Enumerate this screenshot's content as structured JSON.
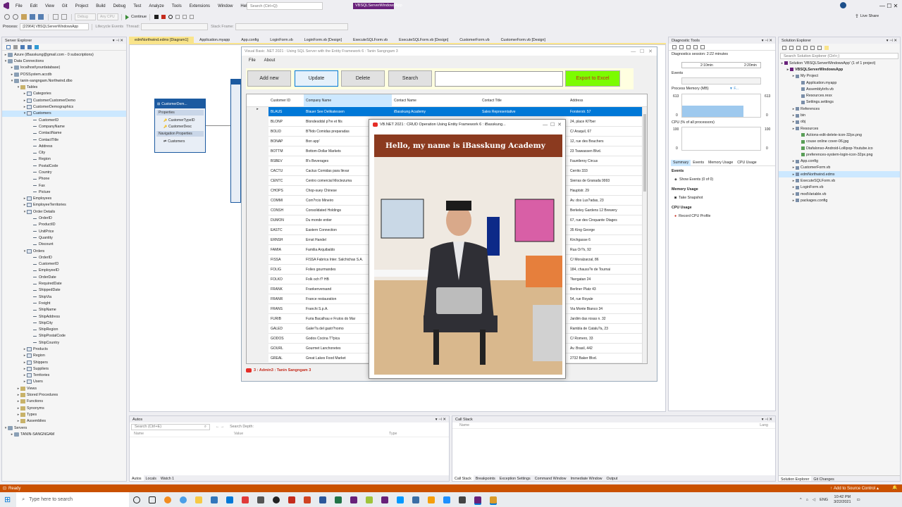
{
  "ide": {
    "menu": [
      "File",
      "Edit",
      "View",
      "Git",
      "Project",
      "Build",
      "Debug",
      "Test",
      "Analyze",
      "Tools",
      "Extensions",
      "Window",
      "Help"
    ],
    "search_placeholder": "Search (Ctrl+Q)",
    "solution_name": "VBSQLServerWindowsApp",
    "live_share": "Live Share",
    "toolbar": {
      "config": "Debug",
      "platform": "Any CPU",
      "continue_label": "Continue",
      "process_label": "Process:",
      "process_value": "[22964] VBSQLServerWindowsApp",
      "lifecycle_label": "Lifecycle Events",
      "thread_label": "Thread:",
      "stack_frame_label": "Stack Frame:"
    }
  },
  "server_explorer": {
    "title": "Server Explorer",
    "items": [
      {
        "indent": 0,
        "exp": "▸",
        "label": "Azure (iBasskung@gmail.com - 0 subscriptions)",
        "icon": "db"
      },
      {
        "indent": 0,
        "exp": "▾",
        "label": "Data Connections",
        "icon": "db"
      },
      {
        "indent": 1,
        "exp": "▸",
        "label": "localhost\\yourdatabase)",
        "icon": "db"
      },
      {
        "indent": 1,
        "exp": "▸",
        "label": "POSSystem.accdb",
        "icon": "db"
      },
      {
        "indent": 1,
        "exp": "▾",
        "label": "tanin-sangngam.Northwind.dbo",
        "icon": "db"
      },
      {
        "indent": 2,
        "exp": "▾",
        "label": "Tables",
        "icon": "fld"
      },
      {
        "indent": 3,
        "exp": "▸",
        "label": "Categories",
        "icon": "tbl"
      },
      {
        "indent": 3,
        "exp": "▸",
        "label": "CustomerCustomerDemo",
        "icon": "tbl"
      },
      {
        "indent": 3,
        "exp": "▸",
        "label": "CustomerDemographics",
        "icon": "tbl"
      },
      {
        "indent": 3,
        "exp": "▾",
        "label": "Customers",
        "icon": "tbl",
        "selected": true
      },
      {
        "indent": 4,
        "exp": "",
        "label": "CustomerID",
        "icon": "col"
      },
      {
        "indent": 4,
        "exp": "",
        "label": "CompanyName",
        "icon": "col"
      },
      {
        "indent": 4,
        "exp": "",
        "label": "ContactName",
        "icon": "col"
      },
      {
        "indent": 4,
        "exp": "",
        "label": "ContactTitle",
        "icon": "col"
      },
      {
        "indent": 4,
        "exp": "",
        "label": "Address",
        "icon": "col"
      },
      {
        "indent": 4,
        "exp": "",
        "label": "City",
        "icon": "col"
      },
      {
        "indent": 4,
        "exp": "",
        "label": "Region",
        "icon": "col"
      },
      {
        "indent": 4,
        "exp": "",
        "label": "PostalCode",
        "icon": "col"
      },
      {
        "indent": 4,
        "exp": "",
        "label": "Country",
        "icon": "col"
      },
      {
        "indent": 4,
        "exp": "",
        "label": "Phone",
        "icon": "col"
      },
      {
        "indent": 4,
        "exp": "",
        "label": "Fax",
        "icon": "col"
      },
      {
        "indent": 4,
        "exp": "",
        "label": "Picture",
        "icon": "col"
      },
      {
        "indent": 3,
        "exp": "▸",
        "label": "Employees",
        "icon": "tbl"
      },
      {
        "indent": 3,
        "exp": "▸",
        "label": "EmployeeTerritories",
        "icon": "tbl"
      },
      {
        "indent": 3,
        "exp": "▾",
        "label": "Order Details",
        "icon": "tbl"
      },
      {
        "indent": 4,
        "exp": "",
        "label": "OrderID",
        "icon": "col"
      },
      {
        "indent": 4,
        "exp": "",
        "label": "ProductID",
        "icon": "col"
      },
      {
        "indent": 4,
        "exp": "",
        "label": "UnitPrice",
        "icon": "col"
      },
      {
        "indent": 4,
        "exp": "",
        "label": "Quantity",
        "icon": "col"
      },
      {
        "indent": 4,
        "exp": "",
        "label": "Discount",
        "icon": "col"
      },
      {
        "indent": 3,
        "exp": "▾",
        "label": "Orders",
        "icon": "tbl"
      },
      {
        "indent": 4,
        "exp": "",
        "label": "OrderID",
        "icon": "col"
      },
      {
        "indent": 4,
        "exp": "",
        "label": "CustomerID",
        "icon": "col"
      },
      {
        "indent": 4,
        "exp": "",
        "label": "EmployeeID",
        "icon": "col"
      },
      {
        "indent": 4,
        "exp": "",
        "label": "OrderDate",
        "icon": "col"
      },
      {
        "indent": 4,
        "exp": "",
        "label": "RequiredDate",
        "icon": "col"
      },
      {
        "indent": 4,
        "exp": "",
        "label": "ShippedDate",
        "icon": "col"
      },
      {
        "indent": 4,
        "exp": "",
        "label": "ShipVia",
        "icon": "col"
      },
      {
        "indent": 4,
        "exp": "",
        "label": "Freight",
        "icon": "col"
      },
      {
        "indent": 4,
        "exp": "",
        "label": "ShipName",
        "icon": "col"
      },
      {
        "indent": 4,
        "exp": "",
        "label": "ShipAddress",
        "icon": "col"
      },
      {
        "indent": 4,
        "exp": "",
        "label": "ShipCity",
        "icon": "col"
      },
      {
        "indent": 4,
        "exp": "",
        "label": "ShipRegion",
        "icon": "col"
      },
      {
        "indent": 4,
        "exp": "",
        "label": "ShipPostalCode",
        "icon": "col"
      },
      {
        "indent": 4,
        "exp": "",
        "label": "ShipCountry",
        "icon": "col"
      },
      {
        "indent": 3,
        "exp": "▸",
        "label": "Products",
        "icon": "tbl"
      },
      {
        "indent": 3,
        "exp": "▸",
        "label": "Region",
        "icon": "tbl"
      },
      {
        "indent": 3,
        "exp": "▸",
        "label": "Shippers",
        "icon": "tbl"
      },
      {
        "indent": 3,
        "exp": "▸",
        "label": "Suppliers",
        "icon": "tbl"
      },
      {
        "indent": 3,
        "exp": "▸",
        "label": "Territories",
        "icon": "tbl"
      },
      {
        "indent": 3,
        "exp": "▸",
        "label": "Users",
        "icon": "tbl"
      },
      {
        "indent": 2,
        "exp": "▸",
        "label": "Views",
        "icon": "fld"
      },
      {
        "indent": 2,
        "exp": "▸",
        "label": "Stored Procedures",
        "icon": "fld"
      },
      {
        "indent": 2,
        "exp": "▸",
        "label": "Functions",
        "icon": "fld"
      },
      {
        "indent": 2,
        "exp": "▸",
        "label": "Synonyms",
        "icon": "fld"
      },
      {
        "indent": 2,
        "exp": "▸",
        "label": "Types",
        "icon": "fld"
      },
      {
        "indent": 2,
        "exp": "▸",
        "label": "Assemblies",
        "icon": "fld"
      },
      {
        "indent": 0,
        "exp": "▾",
        "label": "Servers",
        "icon": "db"
      },
      {
        "indent": 1,
        "exp": "▸",
        "label": "TANIN-SANGNGAM",
        "icon": "db"
      }
    ]
  },
  "doc_tabs": [
    "edmNorthwind.edmx [Diagram1]",
    "Application.myapp",
    "App.config",
    "LoginForm.vb",
    "LoginForm.vb [Design]",
    "ExecuteSQLForm.vb",
    "ExecuteSQLForm.vb [Design]",
    "CustomerForm.vb",
    "CustomerForm.vb [Design]"
  ],
  "entity": {
    "title": "CustomerDem...",
    "properties_label": "Properties",
    "props": [
      "CustomerTypeID",
      "CustomerDesc"
    ],
    "nav_label": "Navigation Properties",
    "navs": [
      "Customers"
    ]
  },
  "app_form": {
    "title": "Visual Basic .NET 2021 : Using SQL Server with the Entity Framework 6 : Tanin Sangngam 3",
    "menu": [
      "File",
      "About"
    ],
    "buttons": {
      "add": "Add new",
      "update": "Update",
      "delete": "Delete",
      "search": "Search",
      "export": "Export to Excel"
    },
    "columns": [
      "Customer ID",
      "Company Name",
      "Contact Name",
      "Contact Title",
      "Address"
    ],
    "rows": [
      [
        "BLAUS",
        "Blauer See Delikatessen",
        "iBasskung Academy",
        "Sales Representative",
        "Forsterstr. 57"
      ],
      [
        "BLONP",
        "Blondesddsl p?re et fils",
        "",
        "",
        "24, place Kl?ber"
      ],
      [
        "BOLID",
        "B?lido Comidas preparadas",
        "",
        "",
        "C/ Araquil, 67"
      ],
      [
        "BONAP",
        "Bon app'",
        "",
        "",
        "12, rue des Bouchers"
      ],
      [
        "BOTTM",
        "Bottom-Dollar Markets",
        "",
        "",
        "23 Tsawassen Blvd."
      ],
      [
        "BSBEV",
        "B's Beverages",
        "",
        "",
        "Fauntleroy Circus"
      ],
      [
        "CACTU",
        "Cactus Comidas para llevar",
        "",
        "",
        "Cerrito 333"
      ],
      [
        "CENTC",
        "Centro comercial Moctezuma",
        "",
        "",
        "Sierras de Granada 9993"
      ],
      [
        "CHOPS",
        "Chop-suey Chinese",
        "",
        "",
        "Hauptstr. 29"
      ],
      [
        "COMMI",
        "Com?rcio Mineiro",
        "",
        "",
        "Av. dos Lus?adas, 23"
      ],
      [
        "CONSH",
        "Consolidated Holdings",
        "",
        "",
        "Berkeley Gardens 12  Brewery"
      ],
      [
        "DUMON",
        "Du monde entier",
        "",
        "",
        "67, rue des Cinquante Otages"
      ],
      [
        "EASTC",
        "Eastern Connection",
        "",
        "",
        "35 King George"
      ],
      [
        "ERNSH",
        "Ernst Handel",
        "",
        "",
        "Kirchgasse 6"
      ],
      [
        "FAMIA",
        "Familia Arquibaldo",
        "",
        "",
        "Rua Or?s, 92"
      ],
      [
        "FISSA",
        "FISSA Fabrica Inter. Salchichas S.A.",
        "",
        "",
        "C/ Moralzarzal, 86"
      ],
      [
        "FOLIG",
        "Folies gourmandes",
        "",
        "",
        "184, chauss?e de Tournai"
      ],
      [
        "FOLKO",
        "Folk och f? HB",
        "",
        "",
        "?kergatan 24"
      ],
      [
        "FRANK",
        "Frankenversand",
        "",
        "",
        "Berliner Platz 43"
      ],
      [
        "FRANR",
        "France restauration",
        "",
        "",
        "54, rue Royale"
      ],
      [
        "FRANS",
        "Franchi S.p.A.",
        "",
        "",
        "Via Monte Bianco 34"
      ],
      [
        "FURIB",
        "Furia Bacalhau e Frutos do Mar",
        "",
        "",
        "Jardim das rosas n. 32"
      ],
      [
        "GALED",
        "Galer?a del gastr?nomo",
        "",
        "",
        "Rambla de Catalu?a, 23"
      ],
      [
        "GODOS",
        "Godos Cocina T?pica",
        "",
        "",
        "C/ Romero, 33"
      ],
      [
        "GOURL",
        "Gourmet Lanchonetes",
        "",
        "",
        "Av. Brasil, 442"
      ],
      [
        "GREAL",
        "Great Lakes Food Market",
        "",
        "",
        "2732 Baker Blvd."
      ]
    ],
    "footer": "3 : Admin3 : Tanin Sangngam 3"
  },
  "popup": {
    "title": "VB.NET 2021 : CRUD Operation Using Entity Framework 6 : iBasskung...",
    "banner": "Hello, my name is iBasskung Academy"
  },
  "diag": {
    "title": "Diagnostic Tools",
    "session": "Diagnostics session: 2:22 minutes",
    "t1": "2:10min",
    "t2": "2:20min",
    "events_label": "Events",
    "mem_label": "Process Memory (MB)",
    "mem_legend": "▼ F...",
    "mem_max": "613",
    "mem_min": "0",
    "cpu_label": "CPU (% of all processors)",
    "cpu_max": "100",
    "cpu_min": "0",
    "tabs": [
      "Summary",
      "Events",
      "Memory Usage",
      "CPU Usage"
    ],
    "sec_events": "Events",
    "show_events": "Show Events (0 of 0)",
    "sec_memory": "Memory Usage",
    "take_snapshot": "Take Snapshot",
    "sec_cpu": "CPU Usage",
    "record_cpu": "Record CPU Profile"
  },
  "solution_explorer": {
    "title": "Solution Explorer",
    "search": "Search Solution Explorer (Ctrl+;)",
    "items": [
      {
        "indent": 0,
        "label": "Solution 'VBSQLServerWindowsApp' (1 of 1 project)"
      },
      {
        "indent": 1,
        "label": "VBSQLServerWindowsApp",
        "bold": true
      },
      {
        "indent": 2,
        "label": "My Project"
      },
      {
        "indent": 3,
        "label": "Application.myapp"
      },
      {
        "indent": 3,
        "label": "AssemblyInfo.vb"
      },
      {
        "indent": 3,
        "label": "Resources.resx"
      },
      {
        "indent": 3,
        "label": "Settings.settings"
      },
      {
        "indent": 2,
        "label": "References"
      },
      {
        "indent": 2,
        "label": "bin"
      },
      {
        "indent": 2,
        "label": "obj"
      },
      {
        "indent": 2,
        "label": "Resources"
      },
      {
        "indent": 3,
        "label": "Actions-edit-delete-icon-32px.png"
      },
      {
        "indent": 3,
        "label": "couse online cover-06.jpg"
      },
      {
        "indent": 3,
        "label": "Dtafalonso-Android-Lollipop-Youtube.ico"
      },
      {
        "indent": 3,
        "label": "preferences-system-login-icon-32px.png"
      },
      {
        "indent": 2,
        "label": "App.config"
      },
      {
        "indent": 2,
        "label": "CustomerForm.vb"
      },
      {
        "indent": 2,
        "label": "edmNorthwind.edmx",
        "selected": true
      },
      {
        "indent": 2,
        "label": "ExecuteSQLForm.vb"
      },
      {
        "indent": 2,
        "label": "LoginForm.vb"
      },
      {
        "indent": 2,
        "label": "modVariable.vb"
      },
      {
        "indent": 2,
        "label": "packages.config"
      }
    ],
    "bottom_tabs": [
      "Solution Explorer",
      "Git Changes"
    ]
  },
  "autos": {
    "title": "Autos",
    "search": "Search (Ctrl+E)",
    "depth": "Search Depth:",
    "cols": [
      "Name",
      "Value",
      "Type"
    ],
    "tabs": [
      "Autos",
      "Locals",
      "Watch 1"
    ]
  },
  "callstack": {
    "title": "Call Stack",
    "cols": [
      "Name",
      "Lang"
    ],
    "tabs": [
      "Call Stack",
      "Breakpoints",
      "Exception Settings",
      "Command Window",
      "Immediate Window",
      "Output"
    ]
  },
  "status": {
    "ready": "Ready",
    "source_control": "Add to Source Control"
  },
  "taskbar": {
    "search": "Type here to search",
    "lang": "ENG",
    "time": "10:42 PM",
    "date": "3/22/2021"
  },
  "colors": {
    "accent": "#0078d7",
    "status": "#ca5100",
    "export": "#7cfc00",
    "banner": "#8b3a1f"
  }
}
